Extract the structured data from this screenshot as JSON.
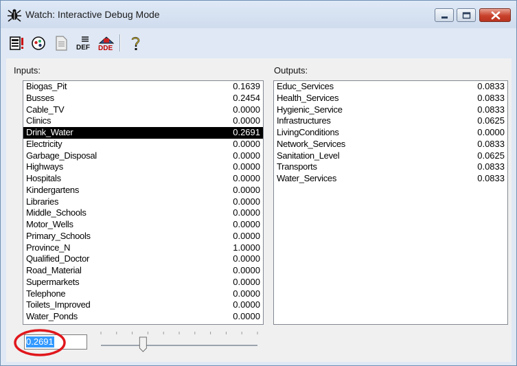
{
  "window": {
    "title": "Watch: Interactive Debug Mode",
    "accent": "#3399ff",
    "selection_bg": "#000000",
    "highlight_ring": "#e0171c"
  },
  "toolbar": {
    "items": [
      {
        "icon": "report-icon"
      },
      {
        "icon": "view-icon"
      },
      {
        "icon": "document-icon"
      },
      {
        "icon": "def-icon",
        "text": "DEF"
      },
      {
        "icon": "dde-icon",
        "text": "DDE"
      },
      {
        "icon": "help-icon"
      }
    ]
  },
  "inputs": {
    "label": "Inputs:",
    "items": [
      {
        "name": "Biogas_Pit",
        "value": "0.1639"
      },
      {
        "name": "Busses",
        "value": "0.2454"
      },
      {
        "name": "Cable_TV",
        "value": "0.0000"
      },
      {
        "name": "Clinics",
        "value": "0.0000"
      },
      {
        "name": "Drink_Water",
        "value": "0.2691",
        "selected": true
      },
      {
        "name": "Electricity",
        "value": "0.0000"
      },
      {
        "name": "Garbage_Disposal",
        "value": "0.0000"
      },
      {
        "name": "Highways",
        "value": "0.0000"
      },
      {
        "name": "Hospitals",
        "value": "0.0000"
      },
      {
        "name": "Kindergartens",
        "value": "0.0000"
      },
      {
        "name": "Libraries",
        "value": "0.0000"
      },
      {
        "name": "Middle_Schools",
        "value": "0.0000"
      },
      {
        "name": "Motor_Wells",
        "value": "0.0000"
      },
      {
        "name": "Primary_Schools",
        "value": "0.0000"
      },
      {
        "name": "Province_N",
        "value": "1.0000"
      },
      {
        "name": "Qualified_Doctor",
        "value": "0.0000"
      },
      {
        "name": "Road_Material",
        "value": "0.0000"
      },
      {
        "name": "Supermarkets",
        "value": "0.0000"
      },
      {
        "name": "Telephone",
        "value": "0.0000"
      },
      {
        "name": "Toilets_Improved",
        "value": "0.0000"
      },
      {
        "name": "Water_Ponds",
        "value": "0.0000"
      }
    ]
  },
  "outputs": {
    "label": "Outputs:",
    "items": [
      {
        "name": "Educ_Services",
        "value": "0.0833"
      },
      {
        "name": "Health_Services",
        "value": "0.0833"
      },
      {
        "name": "Hygienic_Service",
        "value": "0.0833"
      },
      {
        "name": "Infrastructures",
        "value": "0.0625"
      },
      {
        "name": "LivingConditions",
        "value": "0.0000"
      },
      {
        "name": "Network_Services",
        "value": "0.0833"
      },
      {
        "name": "Sanitation_Level",
        "value": "0.0625"
      },
      {
        "name": "Transports",
        "value": "0.0833"
      },
      {
        "name": "Water_Services",
        "value": "0.0833"
      }
    ]
  },
  "value_editor": {
    "value": "0.2691",
    "slider_position": 0.2691
  }
}
